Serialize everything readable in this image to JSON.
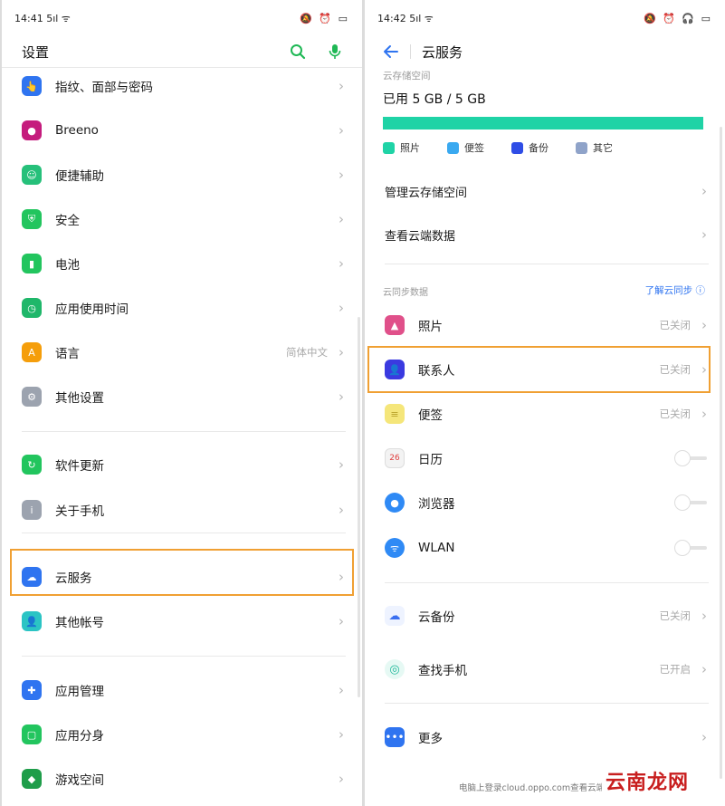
{
  "left": {
    "status": {
      "time": "14:41",
      "signal": "5ıl ᯤ",
      "icons": "🔕 ⏰ ▭"
    },
    "header": {
      "title": "设置"
    },
    "items": [
      {
        "name": "fingerprint",
        "label": "指纹、面部与密码",
        "color": "#2f74f0",
        "glyph": "👆"
      },
      {
        "name": "breeno",
        "label": "Breeno",
        "color": "#c51c7d",
        "glyph": "●"
      },
      {
        "name": "accessibility",
        "label": "便捷辅助",
        "color": "#26c07a",
        "glyph": "☺"
      },
      {
        "name": "security",
        "label": "安全",
        "color": "#22c55e",
        "glyph": "⛨"
      },
      {
        "name": "battery",
        "label": "电池",
        "color": "#22c55e",
        "glyph": "▮"
      },
      {
        "name": "screen-time",
        "label": "应用使用时间",
        "color": "#1fb76a",
        "glyph": "◷"
      },
      {
        "name": "language",
        "label": "语言",
        "value": "简体中文",
        "color": "#f59e0b",
        "glyph": "A"
      },
      {
        "name": "other-settings",
        "label": "其他设置",
        "color": "#9ca3af",
        "glyph": "⚙"
      },
      {
        "name": "software-update",
        "label": "软件更新",
        "color": "#22c55e",
        "glyph": "↻"
      },
      {
        "name": "about-phone",
        "label": "关于手机",
        "color": "#9ca3af",
        "glyph": "i"
      },
      {
        "name": "cloud-service",
        "label": "云服务",
        "color": "#2f74f0",
        "glyph": "☁"
      },
      {
        "name": "other-accounts",
        "label": "其他帐号",
        "color": "#2bc4c4",
        "glyph": "👤"
      },
      {
        "name": "app-management",
        "label": "应用管理",
        "color": "#2f74f0",
        "glyph": "✚"
      },
      {
        "name": "app-clone",
        "label": "应用分身",
        "color": "#22c55e",
        "glyph": "▢"
      },
      {
        "name": "game-space",
        "label": "游戏空间",
        "color": "#1f9d4a",
        "glyph": "◆"
      }
    ]
  },
  "right": {
    "status": {
      "time": "14:42",
      "signal": "5ıl ᯤ",
      "icons": "🔕 ⏰ 🎧 ▭"
    },
    "header": {
      "title": "云服务"
    },
    "storage": {
      "section_label": "云存储空间",
      "usage_text": "已用 5 GB / 5 GB",
      "used_fraction": 1.0,
      "bar_color": "#1fd3a6",
      "legend": [
        {
          "label": "照片",
          "color": "#1fd3a6"
        },
        {
          "label": "便签",
          "color": "#3aa9f0"
        },
        {
          "label": "备份",
          "color": "#2f4de6"
        },
        {
          "label": "其它",
          "color": "#8fa3c9"
        }
      ]
    },
    "manage_storage": "管理云存储空间",
    "view_data": "查看云端数据",
    "sync": {
      "section_label": "云同步数据",
      "learn_link": "了解云同步 ⓘ",
      "items": [
        {
          "name": "photos",
          "label": "照片",
          "status": "已关闭",
          "color": "#e0508a",
          "glyph": "▲"
        },
        {
          "name": "contacts",
          "label": "联系人",
          "status": "已关闭",
          "color": "#3a3ae0",
          "glyph": "👤"
        },
        {
          "name": "notes",
          "label": "便签",
          "status": "已关闭",
          "color": "#f5e67a",
          "glyph": "≡"
        },
        {
          "name": "calendar",
          "label": "日历",
          "color": "#f3f3f3",
          "glyph": "26"
        },
        {
          "name": "browser",
          "label": "浏览器",
          "color": "#2f8af5",
          "glyph": "●"
        },
        {
          "name": "wlan",
          "label": "WLAN",
          "color": "#2f8af5",
          "glyph": "ᯤ"
        }
      ]
    },
    "cloud_backup": {
      "label": "云备份",
      "status": "已关闭"
    },
    "find_phone": {
      "label": "查找手机",
      "status": "已开启"
    },
    "more": {
      "label": "更多"
    },
    "footer_note": "电脑上登录cloud.oppo.com查看云端数据",
    "watermark": "云南龙网"
  }
}
